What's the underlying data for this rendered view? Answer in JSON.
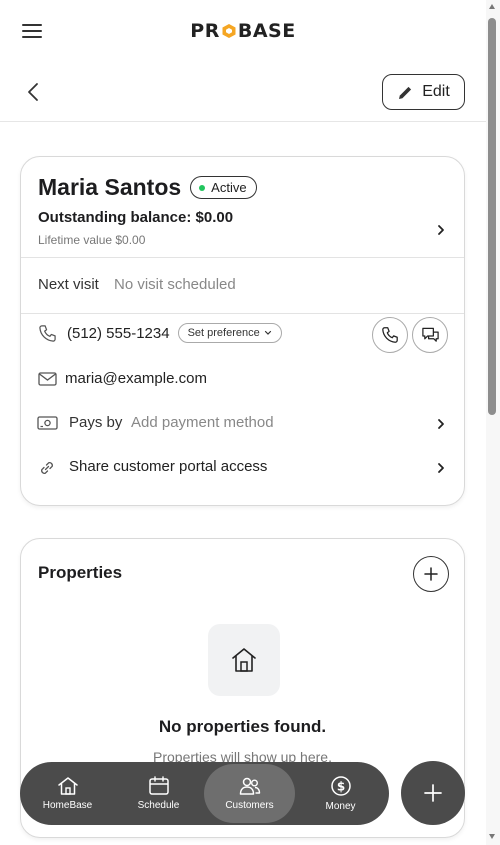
{
  "header": {
    "logo_text_left": "PR",
    "logo_text_right": "BASE",
    "menu_icon": "hamburger-icon"
  },
  "subheader": {
    "back_icon": "chevron-left-icon",
    "edit_label": "Edit"
  },
  "customer": {
    "name": "Maria Santos",
    "status": "Active",
    "status_color": "#22c55e",
    "balance": "Outstanding balance: $0.00",
    "lifetime": "Lifetime value $0.00",
    "next_visit_label": "Next visit",
    "next_visit_value": "No visit scheduled",
    "phone": "(512) 555-1234",
    "preference_label": "Set preference",
    "email": "maria@example.com",
    "pays_by_label": "Pays by",
    "pays_by_value": "Add payment method",
    "portal_label": "Share customer portal access"
  },
  "properties": {
    "title": "Properties",
    "empty_title": "No properties found.",
    "empty_subtitle": "Properties will show up here."
  },
  "nav": {
    "items": [
      {
        "label": "HomeBase",
        "icon": "home-icon",
        "active": false
      },
      {
        "label": "Schedule",
        "icon": "calendar-icon",
        "active": false
      },
      {
        "label": "Customers",
        "icon": "users-icon",
        "active": true
      },
      {
        "label": "Money",
        "icon": "dollar-icon",
        "active": false
      }
    ],
    "fab_icon": "plus-icon"
  },
  "colors": {
    "brand_accent": "#f5a623",
    "nav_background": "#4b4b4b",
    "nav_active": "#6e6e6e"
  }
}
